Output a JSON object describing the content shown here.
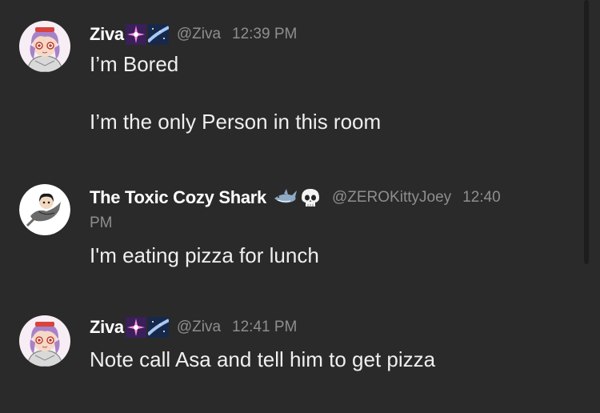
{
  "messages": [
    {
      "username": "Ziva",
      "handle": "@Ziva",
      "time": "12:39 PM",
      "badges": [
        "sparkle-emoji",
        "milky-way-emoji"
      ],
      "lines": [
        "I’m Bored",
        "I’m the only Person in this room"
      ]
    },
    {
      "username": "The Toxic Cozy Shark",
      "handle": "@ZEROKittyJoey",
      "time_part1": "12:40",
      "time_part2": "PM",
      "badges": [
        "shark-emoji",
        "skull-emoji"
      ],
      "lines": [
        "I'm eating pizza for lunch"
      ]
    },
    {
      "username": "Ziva",
      "handle": "@Ziva",
      "time": "12:41 PM",
      "badges": [
        "sparkle-emoji",
        "milky-way-emoji"
      ],
      "lines": [
        "Note call Asa and tell him to get pizza"
      ]
    }
  ],
  "colors": {
    "background": "#2b2a2a",
    "username": "#ffffff",
    "meta": "#8f8e8e",
    "text": "#efefef"
  }
}
